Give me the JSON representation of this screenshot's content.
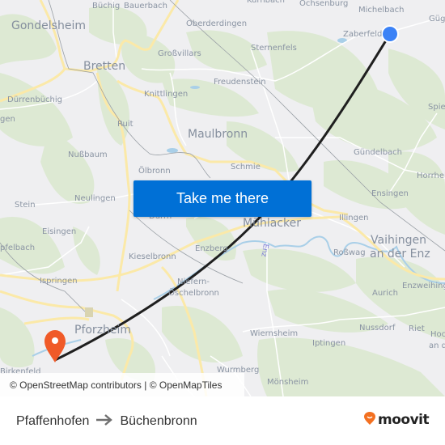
{
  "map": {
    "places": [
      {
        "id": "gondelsheim",
        "label": "Gondelsheim",
        "kind": "town"
      },
      {
        "id": "buechig",
        "label": "Büchig",
        "kind": "village"
      },
      {
        "id": "bauerbach",
        "label": "Bauerbach",
        "kind": "village"
      },
      {
        "id": "kuerbach",
        "label": "Kürnbach",
        "kind": "village"
      },
      {
        "id": "ochsenburg",
        "label": "Ochsenburg",
        "kind": "village"
      },
      {
        "id": "michelbach",
        "label": "Michelbach",
        "kind": "village"
      },
      {
        "id": "guegl",
        "label": "Güg",
        "kind": "village"
      },
      {
        "id": "oberderdingen",
        "label": "Oberderdingen",
        "kind": "village"
      },
      {
        "id": "zaberfeld",
        "label": "Zaberfeld",
        "kind": "village"
      },
      {
        "id": "bretten",
        "label": "Bretten",
        "kind": "city"
      },
      {
        "id": "grossvillars",
        "label": "Großvillars",
        "kind": "village"
      },
      {
        "id": "sternenfels",
        "label": "Sternenfels",
        "kind": "village"
      },
      {
        "id": "freudenstein",
        "label": "Freudenstein",
        "kind": "village"
      },
      {
        "id": "duerrenbuechig",
        "label": "Dürrenbüchig",
        "kind": "village"
      },
      {
        "id": "knittlingen",
        "label": "Knittlingen",
        "kind": "village"
      },
      {
        "id": "gen",
        "label": "gen",
        "kind": "village"
      },
      {
        "id": "spie",
        "label": "Spie",
        "kind": "village"
      },
      {
        "id": "ruit",
        "label": "Ruit",
        "kind": "village"
      },
      {
        "id": "maulbronn",
        "label": "Maulbronn",
        "kind": "town"
      },
      {
        "id": "nussbaum",
        "label": "Nußbaum",
        "kind": "village"
      },
      {
        "id": "guendelbach",
        "label": "Gündelbach",
        "kind": "village"
      },
      {
        "id": "oelbronn",
        "label": "Ölbronn",
        "kind": "village"
      },
      {
        "id": "schmie",
        "label": "Schmie",
        "kind": "village"
      },
      {
        "id": "horrheim",
        "label": "Horrhei",
        "kind": "village"
      },
      {
        "id": "stein",
        "label": "Stein",
        "kind": "village"
      },
      {
        "id": "neulingen",
        "label": "Neulingen",
        "kind": "village"
      },
      {
        "id": "ensingen",
        "label": "Ensingen",
        "kind": "village"
      },
      {
        "id": "duerrn",
        "label": "Dürrn",
        "kind": "village"
      },
      {
        "id": "muehlacker",
        "label": "Mühlacker",
        "kind": "town"
      },
      {
        "id": "illingen",
        "label": "Illingen",
        "kind": "village"
      },
      {
        "id": "eisingen",
        "label": "Eisingen",
        "kind": "village"
      },
      {
        "id": "vaihingen1",
        "label": "Vaihingen",
        "kind": "town"
      },
      {
        "id": "vaihingen2",
        "label": "an der Enz",
        "kind": "town"
      },
      {
        "id": "kaempfelbach",
        "label": "pfelbach",
        "kind": "village"
      },
      {
        "id": "enzberg",
        "label": "Enzberg",
        "kind": "village"
      },
      {
        "id": "rosswag",
        "label": "Roßwag",
        "kind": "village"
      },
      {
        "id": "kieselbronn",
        "label": "Kieselbronn",
        "kind": "village"
      },
      {
        "id": "enz",
        "label": "Enz",
        "kind": "river"
      },
      {
        "id": "enzweihingen",
        "label": "Enzweihing",
        "kind": "village"
      },
      {
        "id": "ispringen",
        "label": "Ispringen",
        "kind": "village"
      },
      {
        "id": "niefern1",
        "label": "Niefern-",
        "kind": "village"
      },
      {
        "id": "niefern2",
        "label": "Öschelbronn",
        "kind": "village"
      },
      {
        "id": "aurich",
        "label": "Aurich",
        "kind": "village"
      },
      {
        "id": "pforzheim",
        "label": "Pforzheim",
        "kind": "town"
      },
      {
        "id": "nussdorf",
        "label": "Nussdorf",
        "kind": "village"
      },
      {
        "id": "riet",
        "label": "Riet",
        "kind": "village"
      },
      {
        "id": "hoch1",
        "label": "Hoc",
        "kind": "village"
      },
      {
        "id": "hoch2",
        "label": "an d",
        "kind": "village"
      },
      {
        "id": "wiernsheim",
        "label": "Wiernsheim",
        "kind": "village"
      },
      {
        "id": "iptingen",
        "label": "Iptingen",
        "kind": "village"
      },
      {
        "id": "birkenfeld",
        "label": "Birkenfeld",
        "kind": "village"
      },
      {
        "id": "wurmberg",
        "label": "Wurmberg",
        "kind": "village"
      },
      {
        "id": "moensheim",
        "label": "Mönsheim",
        "kind": "village"
      }
    ],
    "origin_marker": {
      "label": "origin",
      "color": "#3b82f6"
    },
    "destination_marker": {
      "label": "destination",
      "color": "#f05a28"
    },
    "route_color": "#1f1f1f"
  },
  "cta": {
    "label": "Take me there",
    "color": "#0070d6"
  },
  "attribution": {
    "text": "© OpenStreetMap contributors | © OpenMapTiles"
  },
  "footer": {
    "origin": "Pfaffenhofen",
    "arrow": "⟶",
    "destination": "Büchenbronn",
    "brand": "moovit",
    "brand_color": "#f37021"
  }
}
